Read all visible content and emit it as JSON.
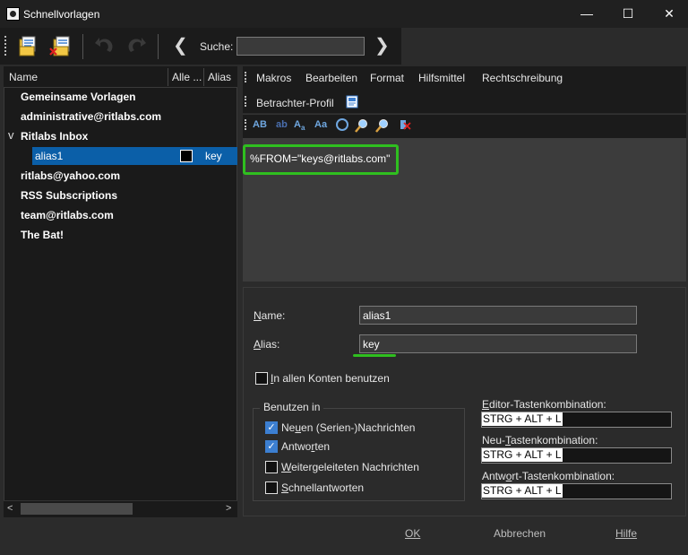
{
  "window": {
    "title": "Schnellvorlagen",
    "minimize": "—",
    "maximize": "☐",
    "close": "✕"
  },
  "toolbar": {
    "search_label": "Suche:",
    "search_value": "",
    "prev": "❮",
    "next": "❯",
    "icons": [
      "new-template-icon",
      "delete-template-icon",
      "undo-icon",
      "redo-icon"
    ]
  },
  "list": {
    "columns": [
      "Name",
      "Alle ...",
      "Alias"
    ],
    "items": [
      {
        "label": "Gemeinsame Vorlagen"
      },
      {
        "label": "administrative@ritlabs.com"
      },
      {
        "label": "Ritlabs Inbox",
        "expander": "v"
      },
      {
        "label": "alias1",
        "alias": "key"
      },
      {
        "label": "ritlabs@yahoo.com"
      },
      {
        "label": "RSS Subscriptions"
      },
      {
        "label": "team@ritlabs.com"
      },
      {
        "label": "The Bat!"
      }
    ],
    "scroll_left": "<",
    "scroll_right": ">"
  },
  "menu": {
    "items": [
      "Makros",
      "Bearbeiten",
      "Format",
      "Hilfsmittel",
      "Rechtschreibung"
    ],
    "viewer_profile": "Betrachter-Profil"
  },
  "editor": {
    "content": "%FROM=\"keys@ritlabs.com\""
  },
  "form": {
    "name_label_u": "N",
    "name_label_rest": "ame:",
    "name_value": "alias1",
    "alias_label_u": "A",
    "alias_label_rest": "lias:",
    "alias_value": "key",
    "all_accounts_u": "I",
    "all_accounts_rest": "n allen Konten benutzen",
    "use_in_label": "Benutzen in",
    "use_in": {
      "new_pre": "Ne",
      "new_u": "u",
      "new_post": "en (Serien-)Nachrichten",
      "reply_pre": "Antwo",
      "reply_u": "r",
      "reply_post": "ten",
      "forward_u": "W",
      "forward_post": "eitergeleiteten Nachrichten",
      "quick_u": "S",
      "quick_post": "chnellantworten"
    },
    "editor_hotkey_u": "E",
    "editor_hotkey_rest": "ditor-Tastenkombination:",
    "editor_hotkey_value": "STRG + ALT + L",
    "new_hotkey_pre": "Neu-",
    "new_hotkey_u": "T",
    "new_hotkey_rest": "astenkombination:",
    "new_hotkey_value": "STRG + ALT + L",
    "reply_hotkey_pre": "Antw",
    "reply_hotkey_u": "o",
    "reply_hotkey_rest": "rt-Tastenkombination:",
    "reply_hotkey_value": "STRG + ALT + L"
  },
  "footer": {
    "ok": "OK",
    "cancel": "Abbrechen",
    "help": "Hilfe"
  },
  "colors": {
    "accent_green": "#2fbf1f",
    "selection_blue": "#0b5fa8"
  }
}
